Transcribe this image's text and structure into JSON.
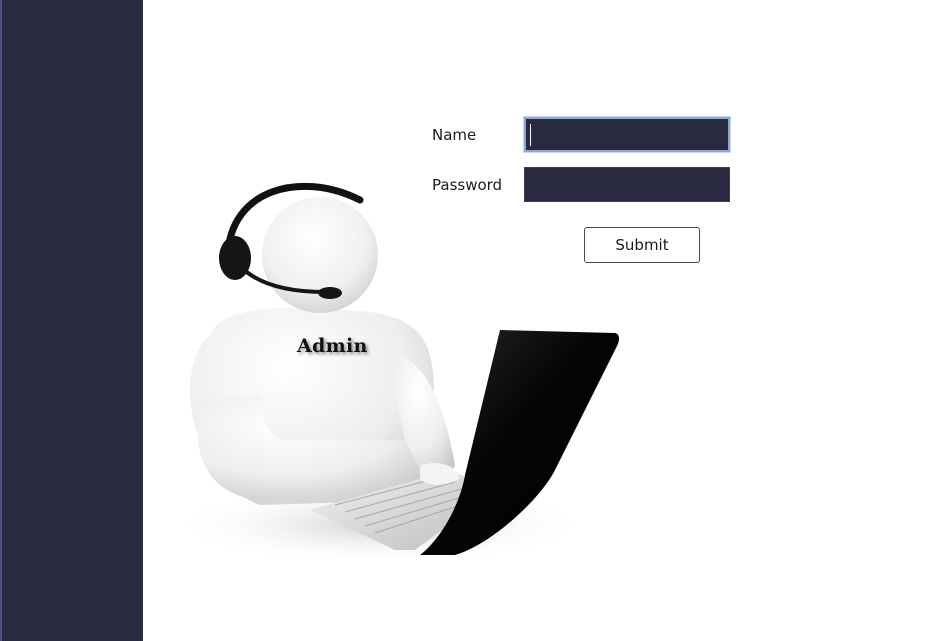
{
  "illustration": {
    "badge_text": "Admin"
  },
  "form": {
    "name_label": "Name",
    "name_value": "",
    "password_label": "Password",
    "password_value": "",
    "submit_label": "Submit"
  },
  "colors": {
    "sidebar_bg": "#292a3f",
    "field_bg": "#292a3f",
    "focus_border": "#8aa7d6"
  }
}
